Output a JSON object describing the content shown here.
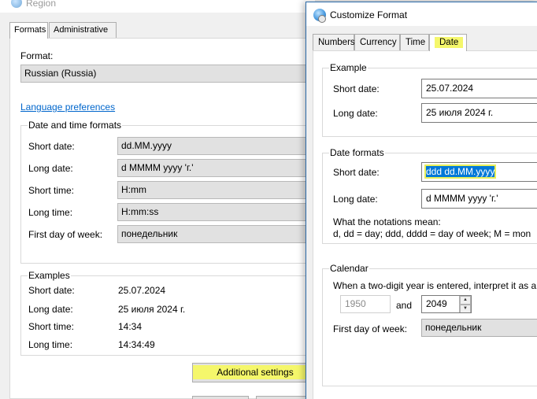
{
  "region": {
    "title": "Region",
    "tabs": [
      "Formats",
      "Administrative"
    ],
    "format_label": "Format:",
    "format_value": "Russian (Russia)",
    "language_link": "Language preferences",
    "dt_group_title": "Date and time formats",
    "dt_rows": [
      {
        "label": "Short date:",
        "value": "dd.MM.yyyy"
      },
      {
        "label": "Long date:",
        "value": "d MMMM yyyy 'г.'"
      },
      {
        "label": "Short time:",
        "value": "H:mm"
      },
      {
        "label": "Long time:",
        "value": "H:mm:ss"
      },
      {
        "label": "First day of week:",
        "value": "понедельник"
      }
    ],
    "examples_title": "Examples",
    "examples": [
      {
        "label": "Short date:",
        "value": "25.07.2024"
      },
      {
        "label": "Long date:",
        "value": "25 июля 2024 г."
      },
      {
        "label": "Short time:",
        "value": "14:34"
      },
      {
        "label": "Long time:",
        "value": "14:34:49"
      }
    ],
    "additional_settings": "Additional settings"
  },
  "customize": {
    "title": "Customize Format",
    "tabs": [
      "Numbers",
      "Currency",
      "Time",
      "Date"
    ],
    "example_title": "Example",
    "example_short_label": "Short date:",
    "example_short_value": "25.07.2024",
    "example_long_label": "Long date:",
    "example_long_value": "25 июля 2024 г.",
    "formats_title": "Date formats",
    "formats_short_label": "Short date:",
    "formats_short_value": "ddd dd.MM.yyyy",
    "formats_long_label": "Long date:",
    "formats_long_value": "d MMMM yyyy 'г.'",
    "notations_title": "What the notations mean:",
    "notations_text": "d, dd = day;  ddd, dddd = day of week;  M = mon",
    "calendar_title": "Calendar",
    "calendar_text": "When a two-digit year is entered, interpret it as a y",
    "year_from": "1950",
    "year_and": "and",
    "year_to": "2049",
    "first_day_label": "First day of week:",
    "first_day_value": "понедельник"
  },
  "highlight_color": "#f5f76b",
  "selection_color": "#0078d7"
}
